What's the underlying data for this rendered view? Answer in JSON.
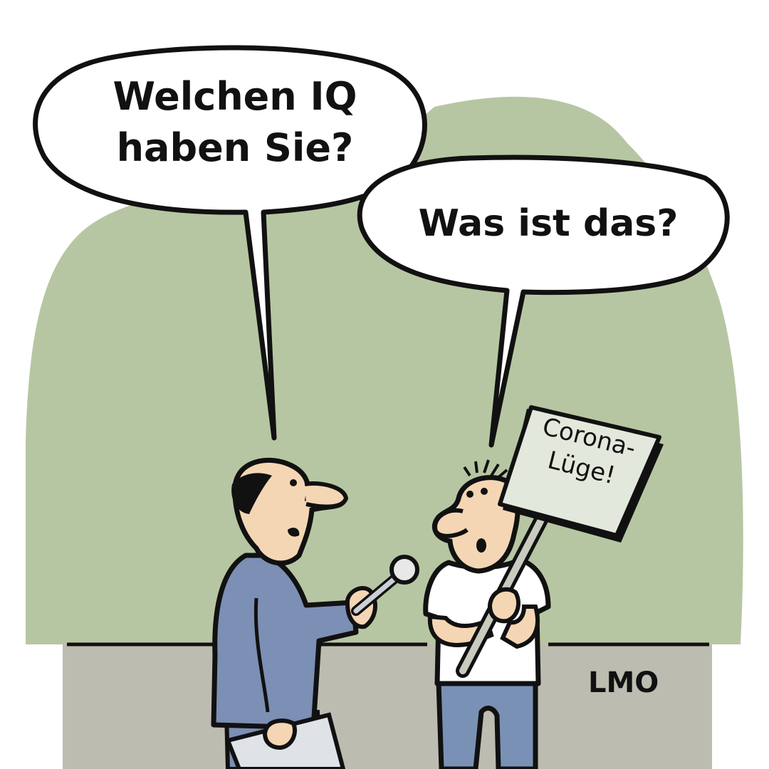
{
  "scene": {
    "colors": {
      "backdrop": "#b7c6a2",
      "floor": "#bcbcb1",
      "ink": "#111111",
      "skin": "#f5d6b4",
      "jacket": "#7c8fb4",
      "jeans": "#7a91b6",
      "shirt": "#ffffff",
      "sign": "#e3e8dc",
      "stick": "#c9cbbf"
    }
  },
  "bubbles": {
    "interviewer": {
      "line1": "Welchen IQ",
      "line2": "haben Sie?"
    },
    "protester": {
      "line1": "Was ist das?"
    }
  },
  "sign": {
    "line1": "Corona-",
    "line2": "Lüge!"
  },
  "signature": {
    "text": "LMO"
  }
}
